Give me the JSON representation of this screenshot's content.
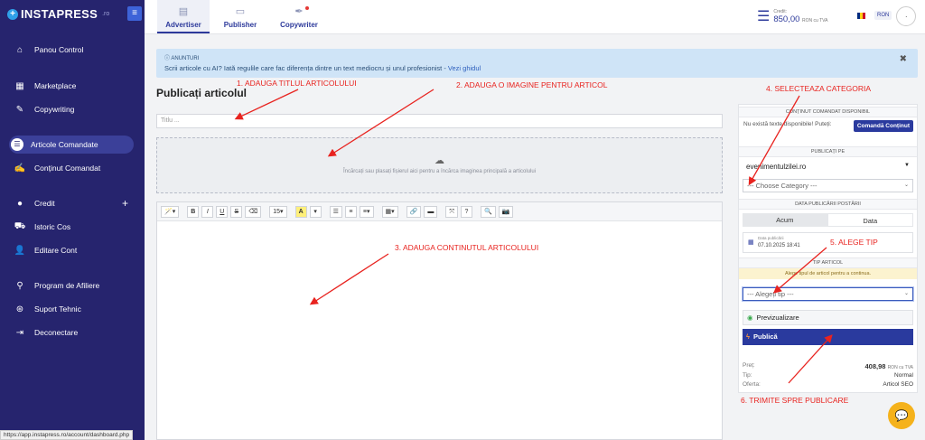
{
  "brand": {
    "name": "INSTAPRESS",
    "suffix": ".ro"
  },
  "sidebar": {
    "items": [
      {
        "label": "Panou Control",
        "icon": "home-icon"
      },
      {
        "label": "Marketplace",
        "icon": "grid-icon"
      },
      {
        "label": "Copywriting",
        "icon": "pen-icon"
      },
      {
        "label": "Articole Comandate",
        "icon": "list-icon",
        "active": true
      },
      {
        "label": "Conținut Comandat",
        "icon": "edit-icon"
      },
      {
        "label": "Credit",
        "icon": "piggy-bank-icon",
        "has_add": true
      },
      {
        "label": "Istoric Cos",
        "icon": "cart-icon"
      },
      {
        "label": "Editare Cont",
        "icon": "user-edit-icon"
      },
      {
        "label": "Program de Afiliere",
        "icon": "affiliate-icon"
      },
      {
        "label": "Suport Tehnic",
        "icon": "lifebuoy-icon"
      },
      {
        "label": "Deconectare",
        "icon": "logout-icon"
      }
    ]
  },
  "status_url": "https://app.instapress.ro/account/dashboard.php",
  "tabs": [
    {
      "label": "Advertiser",
      "icon": "document-icon",
      "active": true
    },
    {
      "label": "Publisher",
      "icon": "newspaper-icon"
    },
    {
      "label": "Copywriter",
      "icon": "feather-icon",
      "notification": true
    }
  ],
  "header": {
    "credit_label": "Credit:",
    "credit_value": "850,00",
    "credit_unit": "RON cu TVA",
    "currency": "RON",
    "avatar_text": "avatar"
  },
  "announcement": {
    "heading": "ANUNTURI",
    "text": "Scrii articole cu AI? Iată regulile care fac diferența dintre un text mediocru și unul profesionist - ",
    "link": "Vezi ghidul",
    "close": "✖"
  },
  "main": {
    "title": "Publicați articolul",
    "title_placeholder": "Titlu ...",
    "dropzone_text": "Încărcați sau plasați fișierul aici pentru a încărca imaginea principală a articolului",
    "toolbar": {
      "magic": "🪄▾",
      "bold": "B",
      "italic": "I",
      "underline": "U",
      "strike": "S",
      "eraser": "⌫",
      "font_size": "15▾",
      "highlight": "A",
      "highlight_drop": "▾",
      "ul": "☰",
      "ol": "≡",
      "align": "≡▾",
      "table": "▦▾",
      "link": "🔗",
      "video": "▬",
      "fullscreen": "⤧",
      "help": "?",
      "zoom": "🔍",
      "camera": "📷"
    }
  },
  "panel": {
    "content_header": "CONȚINUT COMANDAT DISPONIBIL",
    "content_text": "Nu există texte disponibile! Puteți:",
    "content_button": "Comandă Conținut",
    "publish_header": "PUBLICAȚI PE",
    "site": "evenimentulzilei.ro",
    "category": "--- Choose Category ---",
    "date_header": "DATA PUBLICĂRII POSTĂRII",
    "now": "Acum",
    "date_tab": "Data",
    "date_label": "Data publicării",
    "date_value": "07.10.2025 18:41",
    "type_header": "TIP ARTICOL",
    "type_warning": "Alege tipul de articol pentru a continua.",
    "type_select": "--- Alegeți tip ---",
    "preview": "Previzualizare",
    "publish": "Publică",
    "price_label": "Preț:",
    "price_value": "408,98",
    "price_unit": "RON cu TVA",
    "type_label": "Tip:",
    "type_value": "Normal",
    "offer_label": "Oferta:",
    "offer_value": "Articol SEO"
  },
  "annotations": {
    "a1": "1. ADAUGA TITLUL ARTICOLULUI",
    "a2": "2. ADAUGA O IMAGINE PENTRU ARTICOL",
    "a3": "3. ADAUGA CONTINUTUL ARTICOLULUI",
    "a4": "4. SELECTEAZA CATEGORIA",
    "a5": "5. ALEGE TIP",
    "a6": "6. TRIMITE SPRE PUBLICARE"
  },
  "colors": {
    "sidebar": "#26246e",
    "primary": "#2a3a9e",
    "annotation": "#e8231f",
    "chat": "#f5b21b"
  }
}
